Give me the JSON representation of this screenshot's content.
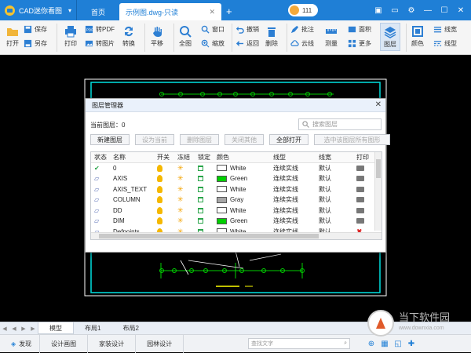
{
  "app": {
    "name": "CAD迷你看图",
    "home_tab": "首页",
    "doc_tab": "示例图.dwg-只读",
    "user_count": "111"
  },
  "ribbon": {
    "open": "打开",
    "save": "保存",
    "save_as": "另存",
    "print": "打印",
    "to_pdf": "转PDF",
    "to_image": "转图片",
    "convert": "转换",
    "pan": "平移",
    "fit": "全图",
    "window": "窗口",
    "zoom": "缩放",
    "undo": "撤销",
    "back": "返回",
    "delete": "删除",
    "annotate": "批注",
    "cloud": "云线",
    "measure": "测量",
    "area": "面积",
    "more": "更多",
    "layer": "图层",
    "color": "颜色",
    "line_width": "线宽",
    "line_type": "线型"
  },
  "dialog": {
    "title": "图层管理器",
    "current_layer": "当前图层：0",
    "search_placeholder": "搜索图层",
    "buttons": [
      "新建图层",
      "设为当前",
      "删除图层",
      "关闭其他",
      "全部打开",
      "选中该图层所有图形"
    ],
    "columns": [
      "状态",
      "名称",
      "开关",
      "冻结",
      "锁定",
      "颜色",
      "线型",
      "线宽",
      "打印"
    ],
    "rows": [
      {
        "status": "✔",
        "name": "0",
        "color": "White",
        "hex": "#ffffff",
        "linetype": "连续实线",
        "width": "默认"
      },
      {
        "status": "▱",
        "name": "AXIS",
        "color": "Green",
        "hex": "#00d000",
        "linetype": "连续实线",
        "width": "默认"
      },
      {
        "status": "▱",
        "name": "AXIS_TEXT",
        "color": "White",
        "hex": "#ffffff",
        "linetype": "连续实线",
        "width": "默认"
      },
      {
        "status": "▱",
        "name": "COLUMN",
        "color": "Gray",
        "hex": "#a6a6a6",
        "linetype": "连续实线",
        "width": "默认"
      },
      {
        "status": "▱",
        "name": "DD",
        "color": "White",
        "hex": "#ffffff",
        "linetype": "连续实线",
        "width": "默认"
      },
      {
        "status": "▱",
        "name": "DIM",
        "color": "Green",
        "hex": "#00d000",
        "linetype": "连续实线",
        "width": "默认"
      },
      {
        "status": "▱",
        "name": "Defpoints",
        "color": "White",
        "hex": "#ffffff",
        "linetype": "连续实线",
        "width": "默认"
      }
    ]
  },
  "layout_tabs": [
    "模型",
    "布局1",
    "布局2"
  ],
  "status": {
    "discover": "发现",
    "design": "设计画图",
    "home": "家装设计",
    "garden": "园林设计",
    "find_placeholder": "查找文字"
  },
  "watermark": {
    "line1": "当下软件园",
    "line2": "www.downxia.com"
  }
}
